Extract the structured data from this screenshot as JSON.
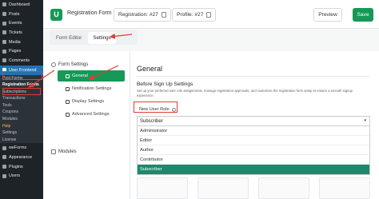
{
  "sidebar": {
    "items": [
      {
        "label": "Dashboard",
        "icon": "dashboard-icon"
      },
      {
        "label": "Posts",
        "icon": "pin-icon"
      },
      {
        "label": "Events",
        "icon": "calendar-icon"
      },
      {
        "label": "Tickets",
        "icon": "ticket-icon"
      },
      {
        "label": "Media",
        "icon": "media-icon"
      },
      {
        "label": "Pages",
        "icon": "page-icon"
      },
      {
        "label": "Comments",
        "icon": "comment-icon"
      },
      {
        "label": "User Frontend",
        "icon": "user-frontend-icon"
      }
    ],
    "submenu": [
      "Post Forms",
      "Registration Forms",
      "Subscriptions",
      "Transactions",
      "Tools",
      "Coupons",
      "Modules",
      "Help",
      "Settings",
      "License"
    ],
    "bottom_items": [
      {
        "label": "weForms",
        "icon": "weforms-icon"
      },
      {
        "label": "Appearance",
        "icon": "appearance-icon"
      },
      {
        "label": "Plugins",
        "icon": "plugin-icon"
      },
      {
        "label": "Users",
        "icon": "users-icon"
      }
    ]
  },
  "topbar": {
    "logo": "U",
    "form_title": "Registration Form",
    "registration_id": "Registration: #27",
    "profile_id": "Profile: #27",
    "preview_label": "Preview",
    "save_label": "Save"
  },
  "tabs": [
    "Form Editor",
    "Settings"
  ],
  "left_menu": {
    "section": "Form Settings",
    "items": [
      "General",
      "Notification Settings",
      "Display Settings",
      "Advanced Settings"
    ],
    "modules": "Modules"
  },
  "content": {
    "title": "General",
    "subtitle": "Before Sign Up Settings",
    "description": "Set up your preferred user role assignments, manage registration approvals, and customize the registration form setup to ensure a smooth signup experience.",
    "field_label": "New User Role",
    "selected_value": "Subscriber",
    "options": [
      "Administrator",
      "Editor",
      "Author",
      "Contributor",
      "Subscriber"
    ]
  },
  "colors": {
    "accent": "#159957",
    "annotation": "#e23b35",
    "wp_sidebar": "#1d2327",
    "wp_active": "#2271b1"
  }
}
